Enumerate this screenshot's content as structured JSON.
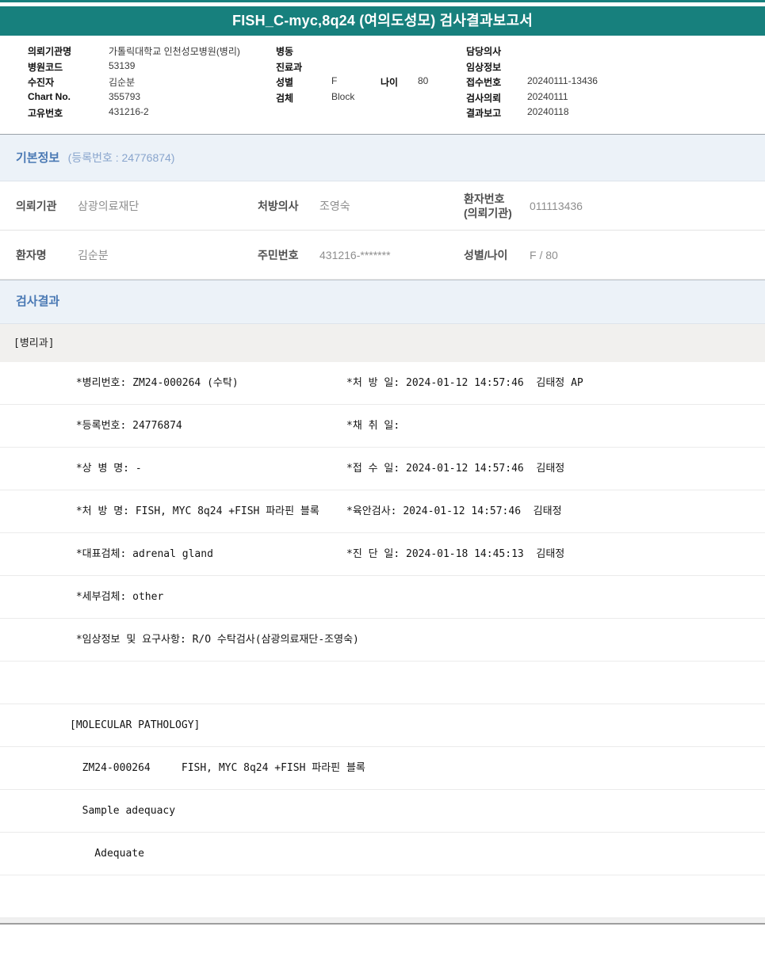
{
  "title": "FISH_C-myc,8q24 (여의도성모) 검사결과보고서",
  "colors": {
    "accent_teal": "#17807d",
    "section_title_blue": "#4a79b4",
    "section_subtitle_blue": "#89a5cd",
    "section_bg": "#ecf2f8",
    "department_bg": "#f1f0ee",
    "label_gray": "#4f4f4f",
    "value_gray": "#8e8e8e"
  },
  "header": {
    "rows": [
      {
        "l_label": "의뢰기관명",
        "l_value": "가톨릭대학교 인천성모병원(병리)",
        "m_label": "병동",
        "m_value": "",
        "r_label": "담당의사",
        "r_value": ""
      },
      {
        "l_label": "병원코드",
        "l_value": "53139",
        "m_label": "진료과",
        "m_value": "",
        "r_label": "임상정보",
        "r_value": ""
      },
      {
        "l_label": "수진자",
        "l_value": "김순분",
        "m_label": "성별",
        "m_value": "F",
        "m_label2": "나이",
        "m_value2": "80",
        "r_label": "접수번호",
        "r_value": "20240111-13436"
      },
      {
        "l_label": "Chart No.",
        "l_value": "355793",
        "m_label": "검체",
        "m_value": "Block",
        "r_label": "검사의뢰",
        "r_value": "20240111"
      },
      {
        "l_label": "고유번호",
        "l_value": "431216-2",
        "m_label": "",
        "m_value": "",
        "r_label": "결과보고",
        "r_value": "20240118"
      }
    ]
  },
  "basic_info": {
    "title": "기본정보",
    "subtitle": "(등록번호 : 24776874)",
    "rows": [
      {
        "c1_label": "의뢰기관",
        "c1_value": "삼광의료재단",
        "c2_label": "처방의사",
        "c2_value": "조영숙",
        "c3_label": "환자번호\n(의뢰기관)",
        "c3_value": "011113436"
      },
      {
        "c1_label": "환자명",
        "c1_value": "김순분",
        "c2_label": "주민번호",
        "c2_value": "431216-*******",
        "c3_label": "성별/나이",
        "c3_value": "F / 80"
      }
    ]
  },
  "results": {
    "title": "검사결과",
    "department": "[병리과]",
    "rows": [
      {
        "left": " *병리번호: ZM24-000264 (수탁)",
        "right": "*처 방 일: 2024-01-12 14:57:46  김태정 AP"
      },
      {
        "left": " *등록번호: 24776874",
        "right": "*채 취 일:"
      },
      {
        "left": " *상 병 명: -",
        "right": "*접 수 일: 2024-01-12 14:57:46  김태정"
      },
      {
        "left": " *처 방 명: FISH, MYC 8q24 +FISH 파라핀 블록",
        "right": "*육안검사: 2024-01-12 14:57:46  김태정"
      },
      {
        "left": " *대표검체: adrenal gland",
        "right": "*진 단 일: 2024-01-18 14:45:13  김태정"
      },
      {
        "left": " *세부검체: other",
        "right": ""
      },
      {
        "left": " *임상정보 및 요구사항: R/O 수탁검사(삼광의료재단-조영숙)",
        "right": ""
      },
      {
        "left": "",
        "right": ""
      },
      {
        "left": "[MOLECULAR PATHOLOGY]",
        "right": ""
      },
      {
        "left": "  ZM24-000264     FISH, MYC 8q24 +FISH 파라핀 블록",
        "right": ""
      },
      {
        "left": "  Sample adequacy",
        "right": ""
      },
      {
        "left": "    Adequate",
        "right": ""
      },
      {
        "left": "",
        "right": ""
      }
    ]
  }
}
